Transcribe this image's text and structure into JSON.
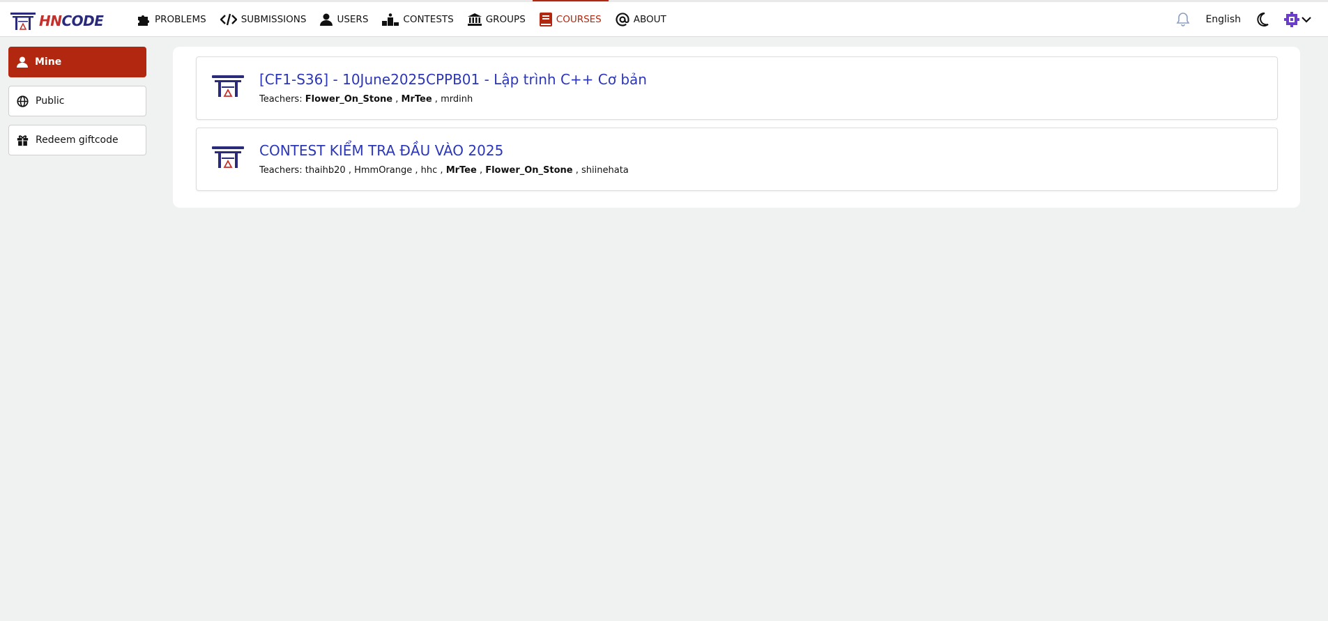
{
  "brand": {
    "prefix": "HN",
    "suffix": "CODE"
  },
  "nav": {
    "items": [
      {
        "label": "PROBLEMS",
        "icon": "puzzle-icon"
      },
      {
        "label": "SUBMISSIONS",
        "icon": "code-icon"
      },
      {
        "label": "USERS",
        "icon": "user-icon"
      },
      {
        "label": "CONTESTS",
        "icon": "podium-icon"
      },
      {
        "label": "GROUPS",
        "icon": "institution-icon"
      },
      {
        "label": "COURSES",
        "icon": "book-icon",
        "active": true
      },
      {
        "label": "ABOUT",
        "icon": "at-icon"
      }
    ]
  },
  "header": {
    "language": "English"
  },
  "sidebar": {
    "items": [
      {
        "label": "Mine",
        "icon": "user-icon",
        "active": true
      },
      {
        "label": "Public",
        "icon": "globe-icon"
      },
      {
        "label": "Redeem giftcode",
        "icon": "gift-icon"
      }
    ]
  },
  "courses": [
    {
      "title": "[CF1-S36] - 10June2025CPPB01 - Lập trình C++ Cơ bản",
      "teachers_label": "Teachers:",
      "teachers": [
        {
          "name": "Flower_On_Stone",
          "bold": true
        },
        {
          "name": "MrTee",
          "bold": true
        },
        {
          "name": "mrdinh",
          "bold": false
        }
      ]
    },
    {
      "title": "CONTEST KIỂM TRA ĐẦU VÀO 2025",
      "teachers_label": "Teachers:",
      "teachers": [
        {
          "name": "thaihb20",
          "bold": false
        },
        {
          "name": "HmmOrange",
          "bold": false
        },
        {
          "name": "hhc",
          "bold": false
        },
        {
          "name": "MrTee",
          "bold": true
        },
        {
          "name": "Flower_On_Stone",
          "bold": true
        },
        {
          "name": "shiinehata",
          "bold": false
        }
      ]
    }
  ],
  "colors": {
    "accent": "#b2270f",
    "link": "#2b36b8",
    "logo": "#2a2a7a",
    "avatar": "#6a3ec9"
  }
}
